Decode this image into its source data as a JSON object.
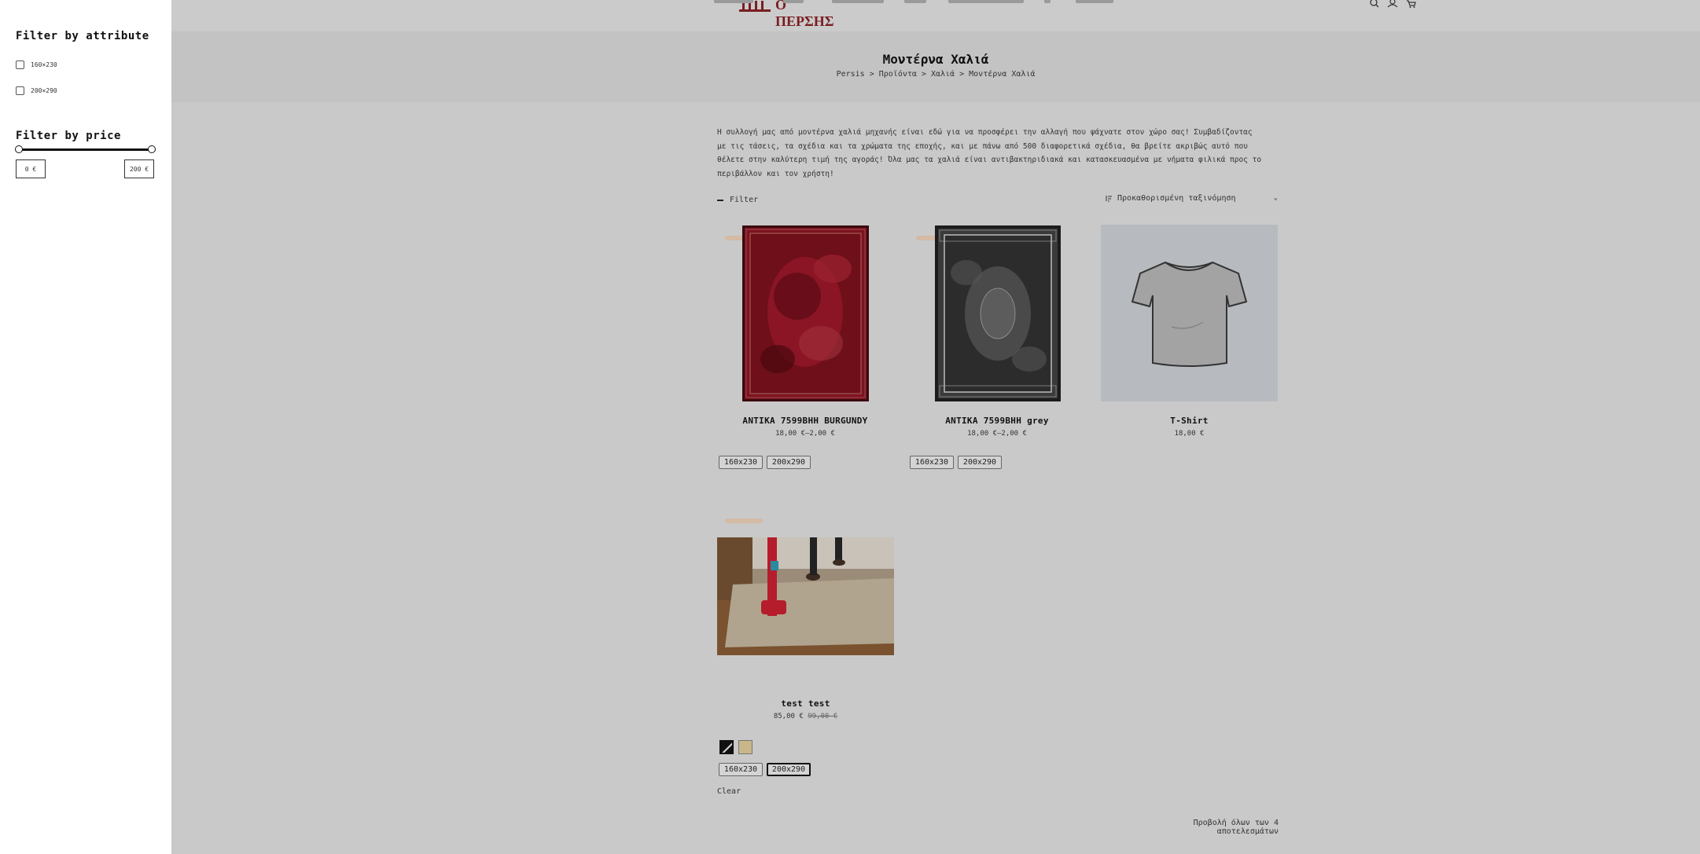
{
  "sidebar": {
    "attribute_title": "Filter by attribute",
    "attributes": [
      {
        "label": "160×230"
      },
      {
        "label": "200×290"
      }
    ],
    "price_title": "Filter by price",
    "price_min": "0 €",
    "price_max": "200 €"
  },
  "header": {
    "logo_text": "Ο ΠΕΡΣΗΣ",
    "brand_color": "#7a1e22",
    "icons": [
      "search-icon",
      "user-icon",
      "cart-icon"
    ]
  },
  "hero": {
    "title": "Μοντέρνα Χαλιά",
    "breadcrumb": "Persis > Προϊόντα > Χαλιά > Μοντέρνα Χαλιά"
  },
  "category_description": [
    "Η συλλογή μας από μοντέρνα χαλιά μηχανής είναι εδώ για να προσφέρει την αλλαγή που ψάχνατε στον χώρο σας! Συμβαδίζοντας",
    "με τις τάσεις, τα σχέδια και τα χρώματα της εποχής, και με πάνω από 500 διαφορετικά σχέδια, θα βρείτε ακριβώς αυτό που",
    "θέλετε στην καλύτερη τιμή της αγοράς! Όλα μας τα χαλιά είναι αντιβακτηριδιακά και κατασκευασμένα με νήματα φιλικά προς το",
    "περιβάλλον και τον χρήστη!"
  ],
  "toolbar": {
    "filter_label": "Filter",
    "sort_label": "Προκαθορισμένη ταξινόμηση"
  },
  "products": [
    {
      "title": "ANTIKA 7599BHH BURGUNDY",
      "price": "18,00 €–2,00 €",
      "sizes": [
        "160x230",
        "200x290"
      ]
    },
    {
      "title": "ANTIKA 7599BHH grey",
      "price": "18,00 €–2,00 €",
      "sizes": [
        "160x230",
        "200x290"
      ]
    },
    {
      "title": "T-Shirt",
      "price": "18,00 €"
    },
    {
      "title": "test test",
      "price": "85,00 €",
      "old_price": "99,00 €",
      "sizes": [
        "160x230",
        "200x290"
      ],
      "selected_size": "200x290"
    }
  ],
  "clear_label": "Clear",
  "results_label": "Προβολή όλων των 4 αποτελεσμάτων"
}
